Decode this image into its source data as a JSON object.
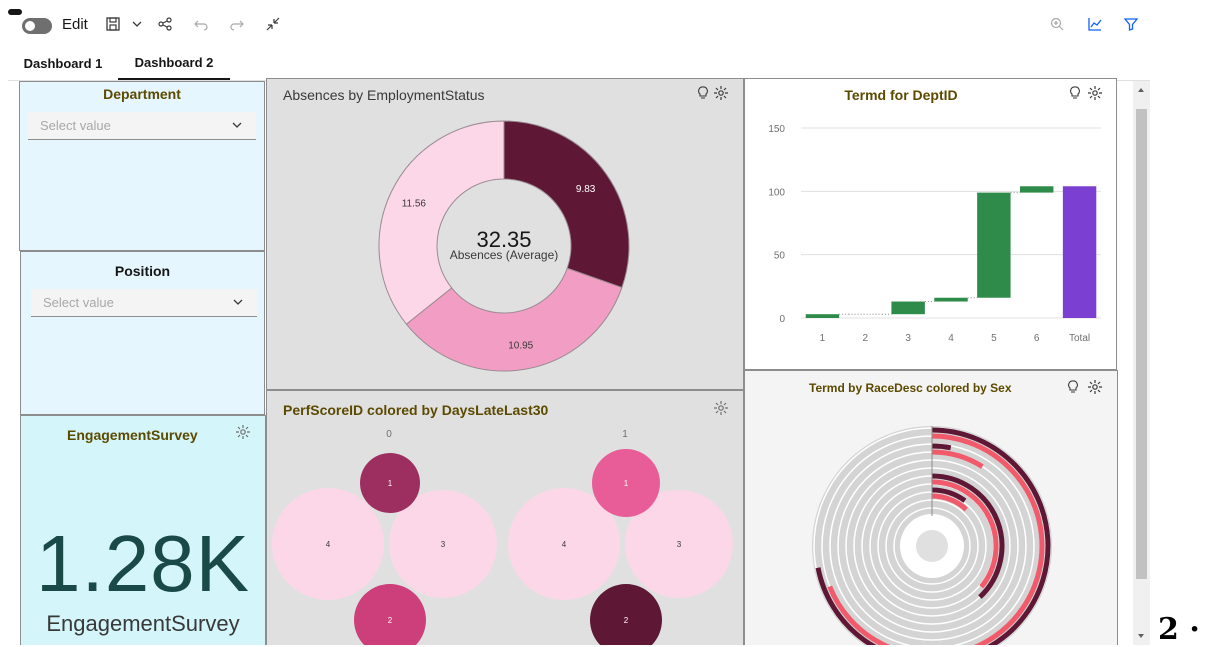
{
  "toolbar": {
    "edit_label": "Edit",
    "icons": [
      "toggle",
      "save-icon",
      "chevron-down-icon",
      "share-icon",
      "undo-icon",
      "redo-icon",
      "collapse-icon",
      "zoom-icon",
      "chart-icon",
      "filter-icon"
    ]
  },
  "tabs": [
    {
      "label": "Dashboard 1",
      "active": false
    },
    {
      "label": "Dashboard 2",
      "active": true
    }
  ],
  "filters": {
    "department": {
      "title": "Department",
      "placeholder": "Select value"
    },
    "position": {
      "title": "Position",
      "placeholder": "Select value"
    }
  },
  "engagement": {
    "title": "EngagementSurvey",
    "value": "1.28K",
    "caption": "EngagementSurvey"
  },
  "absences": {
    "title": "Absences by EmploymentStatus",
    "center_value": "32.35",
    "center_label": "Absences (Average)",
    "chart_data": {
      "type": "pie",
      "values": [
        9.83,
        10.95,
        11.56
      ],
      "labels": [
        "9.83",
        "10.95",
        "11.56"
      ],
      "colors": [
        "#5e1835",
        "#f29ec4",
        "#fcd7e7"
      ]
    }
  },
  "termd_dept": {
    "title": "Termd for DeptID",
    "chart_data": {
      "type": "bar",
      "categories": [
        "1",
        "2",
        "3",
        "4",
        "5",
        "6",
        "Total"
      ],
      "steps": [
        {
          "start": 0,
          "end": 3
        },
        {
          "start": 3,
          "end": 3
        },
        {
          "start": 3,
          "end": 13
        },
        {
          "start": 13,
          "end": 16
        },
        {
          "start": 16,
          "end": 99
        },
        {
          "start": 99,
          "end": 104
        },
        {
          "start": 0,
          "end": 104,
          "total": true
        }
      ],
      "yticks": [
        "0",
        "50",
        "100",
        "150"
      ],
      "ylim": [
        0,
        150
      ],
      "colors": {
        "increase": "#2e8b4a",
        "total": "#7b3fd1"
      }
    }
  },
  "perf": {
    "title": "PerfScoreID colored by DaysLateLast30",
    "groups": [
      {
        "header": "0",
        "bubbles": [
          {
            "label": "1",
            "color": "#9c2f5f",
            "r": 0.15
          },
          {
            "label": "4",
            "color": "#fcd7e7",
            "r": 0.28
          },
          {
            "label": "3",
            "color": "#fcd7e7",
            "r": 0.27
          },
          {
            "label": "2",
            "color": "#cc3f7a",
            "r": 0.18
          }
        ]
      },
      {
        "header": "1",
        "bubbles": [
          {
            "label": "1",
            "color": "#e85d98",
            "r": 0.17
          },
          {
            "label": "4",
            "color": "#fcd7e7",
            "r": 0.28
          },
          {
            "label": "3",
            "color": "#fcd7e7",
            "r": 0.27
          },
          {
            "label": "2",
            "color": "#5e1835",
            "r": 0.18
          }
        ]
      }
    ]
  },
  "termd_race": {
    "title": "Termd by RaceDesc colored by Sex"
  },
  "page_number": "2 ·"
}
